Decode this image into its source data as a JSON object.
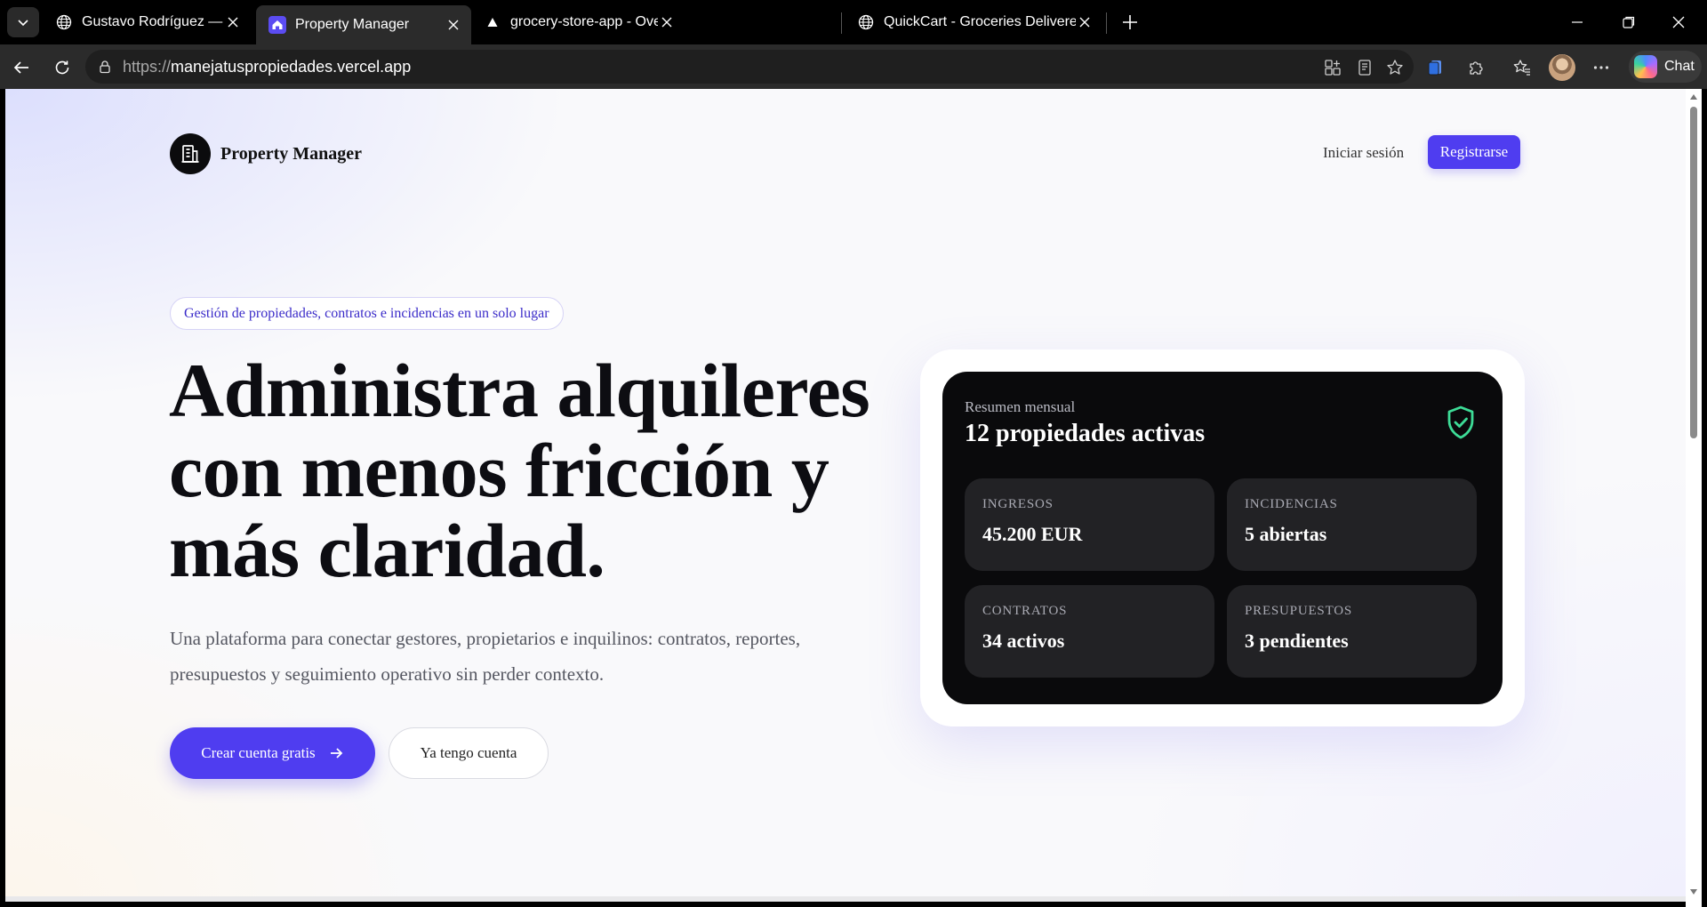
{
  "browser": {
    "tabs": [
      {
        "title": "Gustavo Rodríguez — Portfolio",
        "favicon": "globe-icon",
        "active": false
      },
      {
        "title": "Property Manager",
        "favicon": "home-icon",
        "active": true
      },
      {
        "title": "grocery-store-app - Overview – Ve",
        "favicon": "triangle-icon",
        "active": false
      },
      {
        "title": "QuickCart - Groceries Delivered in",
        "favicon": "globe-icon",
        "active": false
      }
    ],
    "url_scheme": "https://",
    "url_host": "manejatuspropiedades.vercel.app",
    "chat_label": "Chat"
  },
  "nav": {
    "brand": "Property Manager",
    "login": "Iniciar sesión",
    "register": "Registrarse"
  },
  "hero": {
    "badge": "Gestión de propiedades, contratos e incidencias en un solo lugar",
    "title_line1": "Administra alquileres",
    "title_line2": "con menos fricción y",
    "title_line3": "más claridad.",
    "subtitle": "Una plataforma para conectar gestores, propietarios e inquilinos: contratos, reportes, presupuestos y seguimiento operativo sin perder contexto.",
    "cta_primary": "Crear cuenta gratis",
    "cta_secondary": "Ya tengo cuenta"
  },
  "summary": {
    "caption": "Resumen mensual",
    "headline": "12 propiedades activas",
    "tiles": [
      {
        "label": "Ingresos",
        "value": "45.200 EUR"
      },
      {
        "label": "Incidencias",
        "value": "5 abiertas"
      },
      {
        "label": "Contratos",
        "value": "34 activos"
      },
      {
        "label": "Presupuestos",
        "value": "3 pendientes"
      }
    ]
  },
  "colors": {
    "accent": "#4f3df0",
    "card_bg": "#0a0a0c",
    "tile_bg": "#222225",
    "shield": "#3ddc97"
  }
}
